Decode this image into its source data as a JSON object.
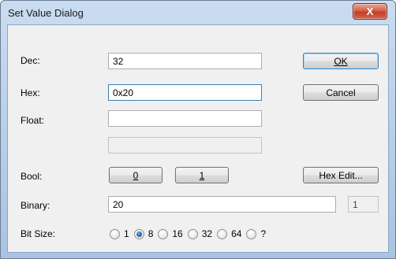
{
  "window": {
    "title": "Set Value Dialog",
    "close_glyph": "X"
  },
  "fields": {
    "dec": {
      "label": "Dec:",
      "value": "32"
    },
    "hex": {
      "label": "Hex:",
      "value": "0x20"
    },
    "float": {
      "label": "Float:",
      "value": "",
      "secondary_value": ""
    },
    "bool": {
      "label": "Bool:",
      "button_0": "0",
      "button_1": "1"
    },
    "binary": {
      "label": "Binary:",
      "value": "20",
      "count": "1"
    },
    "bit_size": {
      "label": "Bit Size:",
      "options": [
        "1",
        "8",
        "16",
        "32",
        "64",
        "?"
      ],
      "selected": "8"
    }
  },
  "buttons": {
    "ok": "OK",
    "cancel": "Cancel",
    "hex_edit": "Hex Edit..."
  }
}
